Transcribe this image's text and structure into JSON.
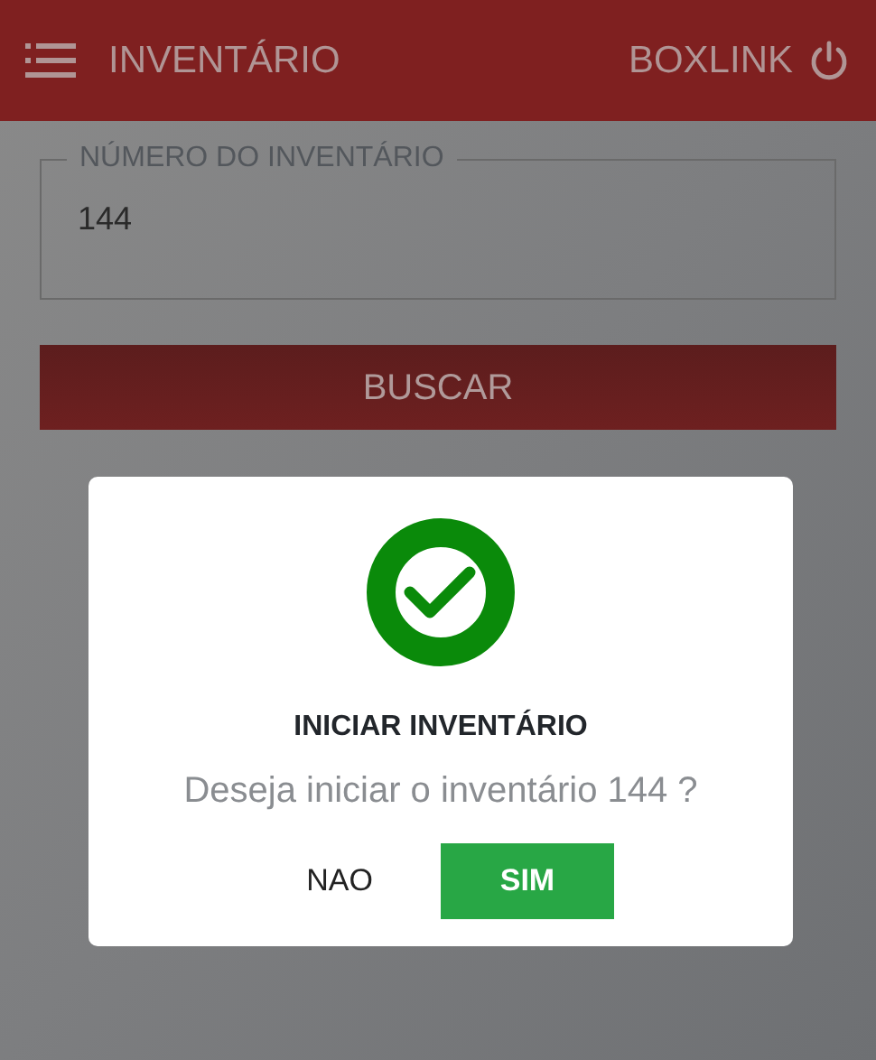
{
  "header": {
    "title": "INVENTÁRIO",
    "brand": "BOXLINK"
  },
  "form": {
    "field": {
      "label": "NÚMERO DO INVENTÁRIO",
      "value": "144"
    },
    "search_button": "BUSCAR"
  },
  "dialog": {
    "kind": "success",
    "title": "INICIAR INVENTÁRIO",
    "message": "Deseja iniciar o inventário 144 ?",
    "buttons": [
      {
        "label": "NAO",
        "kind": "plain"
      },
      {
        "label": "SIM",
        "kind": "primary"
      }
    ]
  }
}
